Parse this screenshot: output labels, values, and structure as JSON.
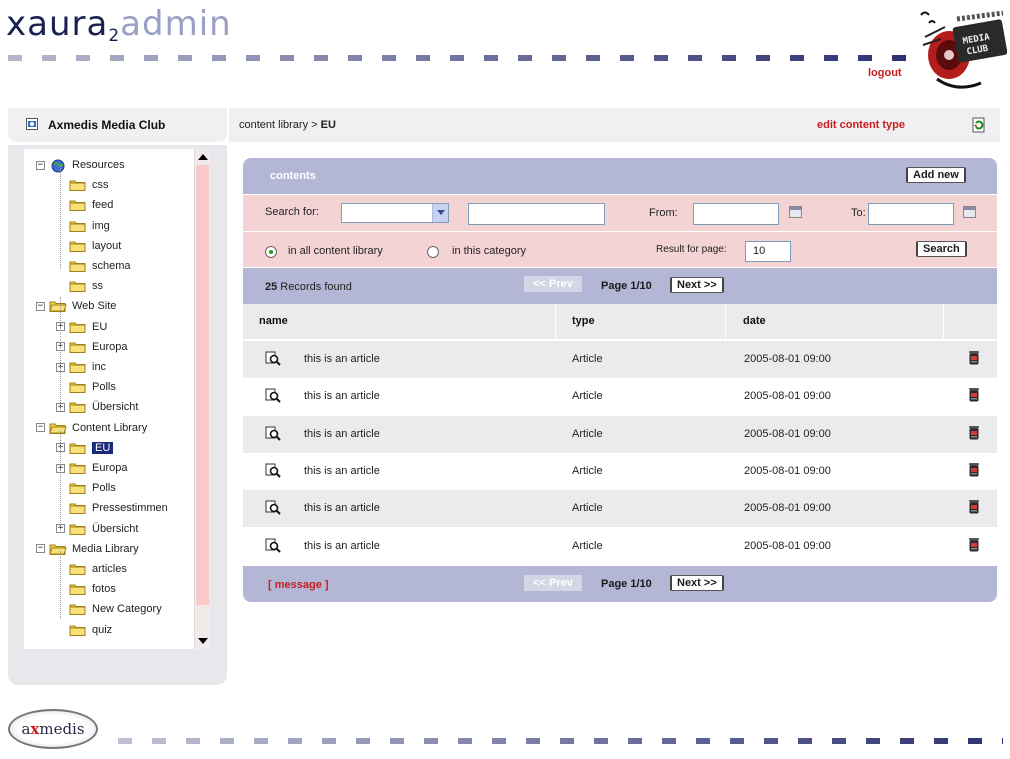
{
  "header": {
    "logo_part1": "xaura",
    "logo_sub": "2",
    "logo_part2": "admin",
    "logout": "logout",
    "badge_text": "MEDIA CLUB"
  },
  "sidebar": {
    "title": "Axmedis Media Club",
    "tree": [
      {
        "label": "Resources",
        "level": 0,
        "expander": "−",
        "icon": "globe-icon"
      },
      {
        "label": "css",
        "level": 1,
        "expander": "",
        "icon": "folder-icon"
      },
      {
        "label": "feed",
        "level": 1,
        "expander": "",
        "icon": "folder-icon"
      },
      {
        "label": "img",
        "level": 1,
        "expander": "",
        "icon": "folder-icon"
      },
      {
        "label": "layout",
        "level": 1,
        "expander": "",
        "icon": "folder-icon"
      },
      {
        "label": "schema",
        "level": 1,
        "expander": "",
        "icon": "folder-icon"
      },
      {
        "label": "ss",
        "level": 1,
        "expander": "",
        "icon": "folder-icon"
      },
      {
        "label": "Web Site",
        "level": 0,
        "expander": "−",
        "icon": "open-folder-icon"
      },
      {
        "label": "EU",
        "level": 1,
        "expander": "+",
        "icon": "folder-icon"
      },
      {
        "label": "Europa",
        "level": 1,
        "expander": "+",
        "icon": "folder-icon"
      },
      {
        "label": "inc",
        "level": 1,
        "expander": "+",
        "icon": "folder-icon"
      },
      {
        "label": "Polls",
        "level": 1,
        "expander": "",
        "icon": "folder-icon"
      },
      {
        "label": "Übersicht",
        "level": 1,
        "expander": "+",
        "icon": "folder-icon"
      },
      {
        "label": "Content Library",
        "level": 0,
        "expander": "−",
        "icon": "open-folder-icon"
      },
      {
        "label": "EU",
        "level": 1,
        "expander": "+",
        "icon": "folder-icon",
        "selected": true
      },
      {
        "label": "Europa",
        "level": 1,
        "expander": "+",
        "icon": "folder-icon"
      },
      {
        "label": "Polls",
        "level": 1,
        "expander": "",
        "icon": "folder-icon"
      },
      {
        "label": "Pressestimmen",
        "level": 1,
        "expander": "",
        "icon": "folder-icon"
      },
      {
        "label": "Übersicht",
        "level": 1,
        "expander": "+",
        "icon": "folder-icon"
      },
      {
        "label": "Media Library",
        "level": 0,
        "expander": "−",
        "icon": "open-folder-icon"
      },
      {
        "label": "articles",
        "level": 1,
        "expander": "",
        "icon": "folder-icon"
      },
      {
        "label": "fotos",
        "level": 1,
        "expander": "",
        "icon": "folder-icon"
      },
      {
        "label": "New Category",
        "level": 1,
        "expander": "",
        "icon": "folder-icon"
      },
      {
        "label": "quiz",
        "level": 1,
        "expander": "",
        "icon": "folder-icon"
      }
    ]
  },
  "breadcrumb": {
    "path": "content library > ",
    "current": "EU",
    "edit_label": "edit content type"
  },
  "contents": {
    "title": "contents",
    "add_new": "Add new"
  },
  "search": {
    "search_for_label": "Search for:",
    "select_value": "",
    "text_value": "",
    "from_label": "From:",
    "from_value": "",
    "to_label": "To:",
    "to_value": "",
    "scope_all": "in all content library",
    "scope_category": "in this category",
    "result_per_page_label": "Result for page:",
    "result_per_page_value": "10",
    "search_button": "Search"
  },
  "pager": {
    "records_count": "25",
    "records_label": " Records found",
    "prev": "<< Prev",
    "page_info": "Page 1/10",
    "next": "Next >>",
    "message": "[ message ]"
  },
  "table": {
    "columns": [
      "name",
      "type",
      "date"
    ],
    "rows": [
      {
        "name": "this is an article",
        "type": "Article",
        "date": "2005-08-01  09:00"
      },
      {
        "name": "this is an article",
        "type": "Article",
        "date": "2005-08-01  09:00"
      },
      {
        "name": "this is an article",
        "type": "Article",
        "date": "2005-08-01  09:00"
      },
      {
        "name": "this is an article",
        "type": "Article",
        "date": "2005-08-01  09:00"
      },
      {
        "name": "this is an article",
        "type": "Article",
        "date": "2005-08-01  09:00"
      },
      {
        "name": "this is an article",
        "type": "Article",
        "date": "2005-08-01  09:00"
      }
    ]
  },
  "footer": {
    "logo_a": "a",
    "logo_x": "x",
    "logo_rest": "medis"
  },
  "colors": {
    "brand_navy": "#1a2050",
    "accent_red": "#c81e1e",
    "bar_lavender": "#b3b6d5",
    "search_pink": "#f4d3d4"
  }
}
